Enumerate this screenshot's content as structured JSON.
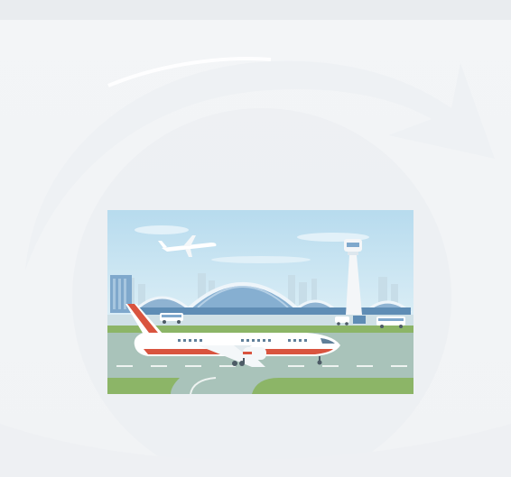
{
  "illustration": {
    "subject": "airport-terminal-with-airliner-on-runway",
    "colors": {
      "sky": "#bfe0ef",
      "sky_light": "#dcecf3",
      "terminal_glass": "#8fb6d6",
      "terminal_frame": "#eef5fa",
      "grass": "#7fae5c",
      "tarmac": "#a9c2b9",
      "plane_body": "#ffffff",
      "plane_stripe": "#d9543f",
      "tower": "#f4f6f8"
    }
  }
}
